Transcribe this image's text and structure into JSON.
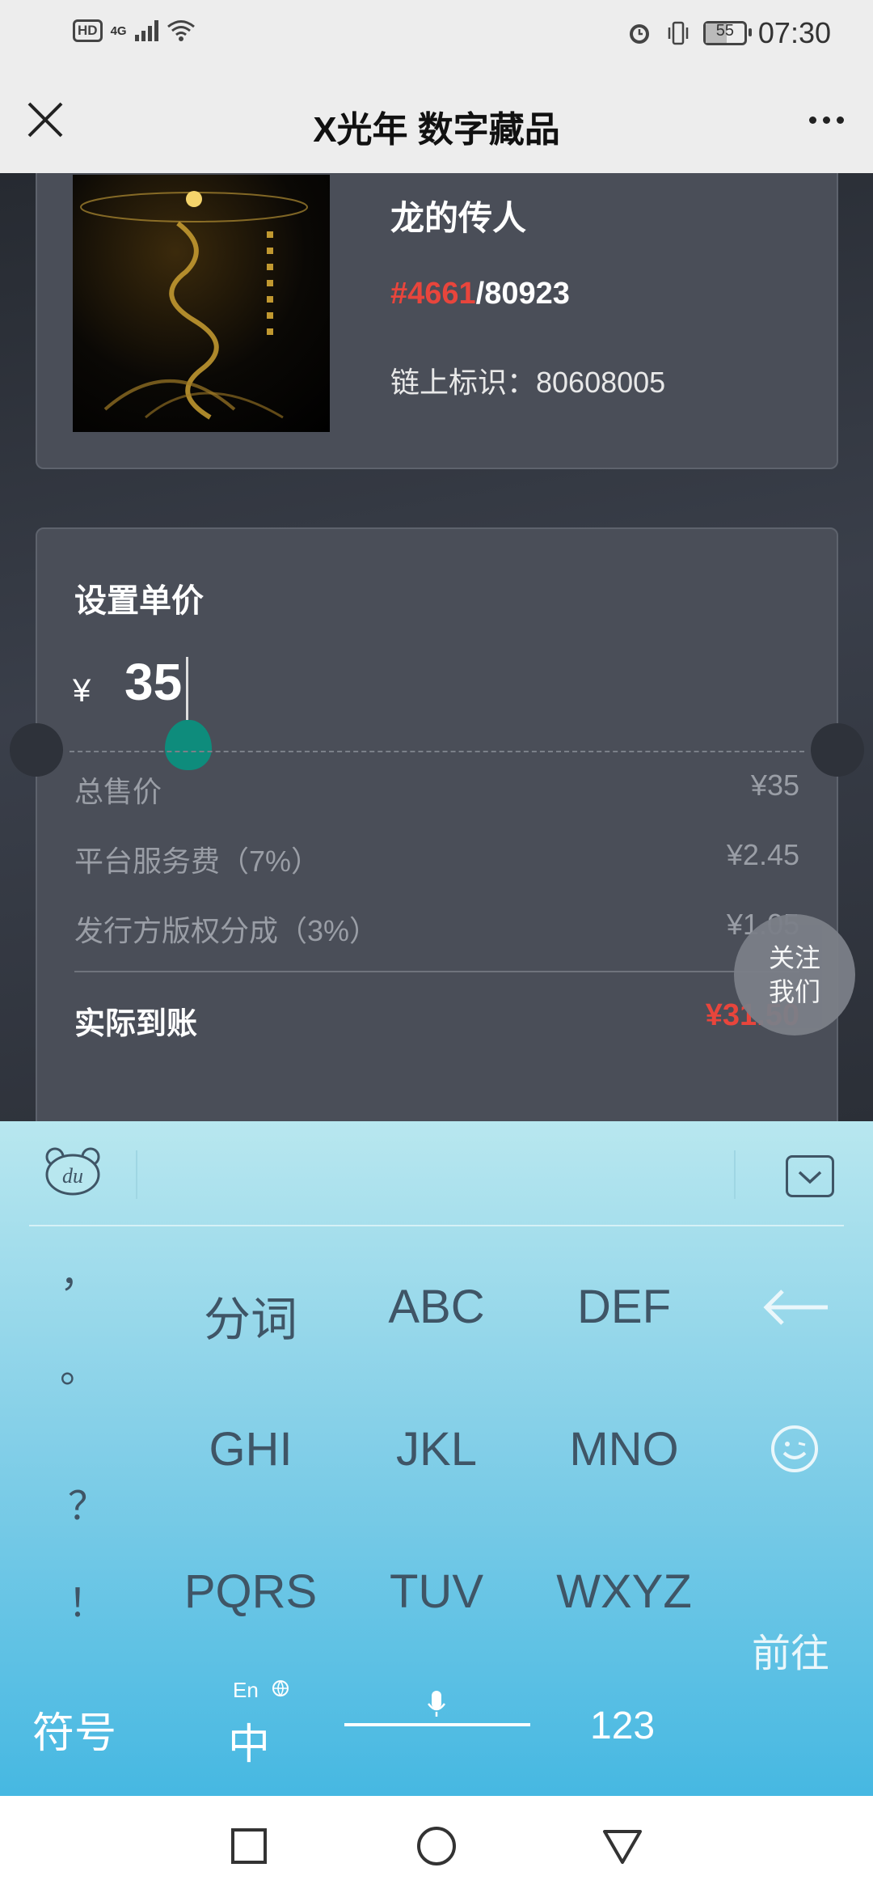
{
  "status_bar": {
    "time": "07:30",
    "battery": "55",
    "network": "4G",
    "hd": "HD"
  },
  "header": {
    "title": "X光年 数字藏品"
  },
  "nft": {
    "name": "龙的传人",
    "serial_current": "#4661",
    "serial_total": "/80923",
    "chain_id": "链上标识：80608005"
  },
  "price": {
    "label": "设置单价",
    "currency": "¥",
    "value": "35"
  },
  "fees": {
    "total_label": "总售价",
    "total_value": "¥35",
    "service_label": "平台服务费（7%）",
    "service_value": "¥2.45",
    "royalty_label": "发行方版权分成（3%）",
    "royalty_value": "¥1.05",
    "receive_label": "实际到账",
    "receive_value": "¥31.50"
  },
  "follow": {
    "line1": "关注",
    "line2": "我们"
  },
  "keyboard": {
    "punct": [
      "，",
      "。",
      "？",
      "！"
    ],
    "row1": [
      "分词",
      "ABC",
      "DEF"
    ],
    "row2": [
      "GHI",
      "JKL",
      "MNO"
    ],
    "row3": [
      "PQRS",
      "TUV",
      "WXYZ"
    ],
    "enter": "前往",
    "symbols": "符号",
    "lang_small": "En",
    "lang_main": "中",
    "numbers": "123",
    "logo": "du"
  }
}
